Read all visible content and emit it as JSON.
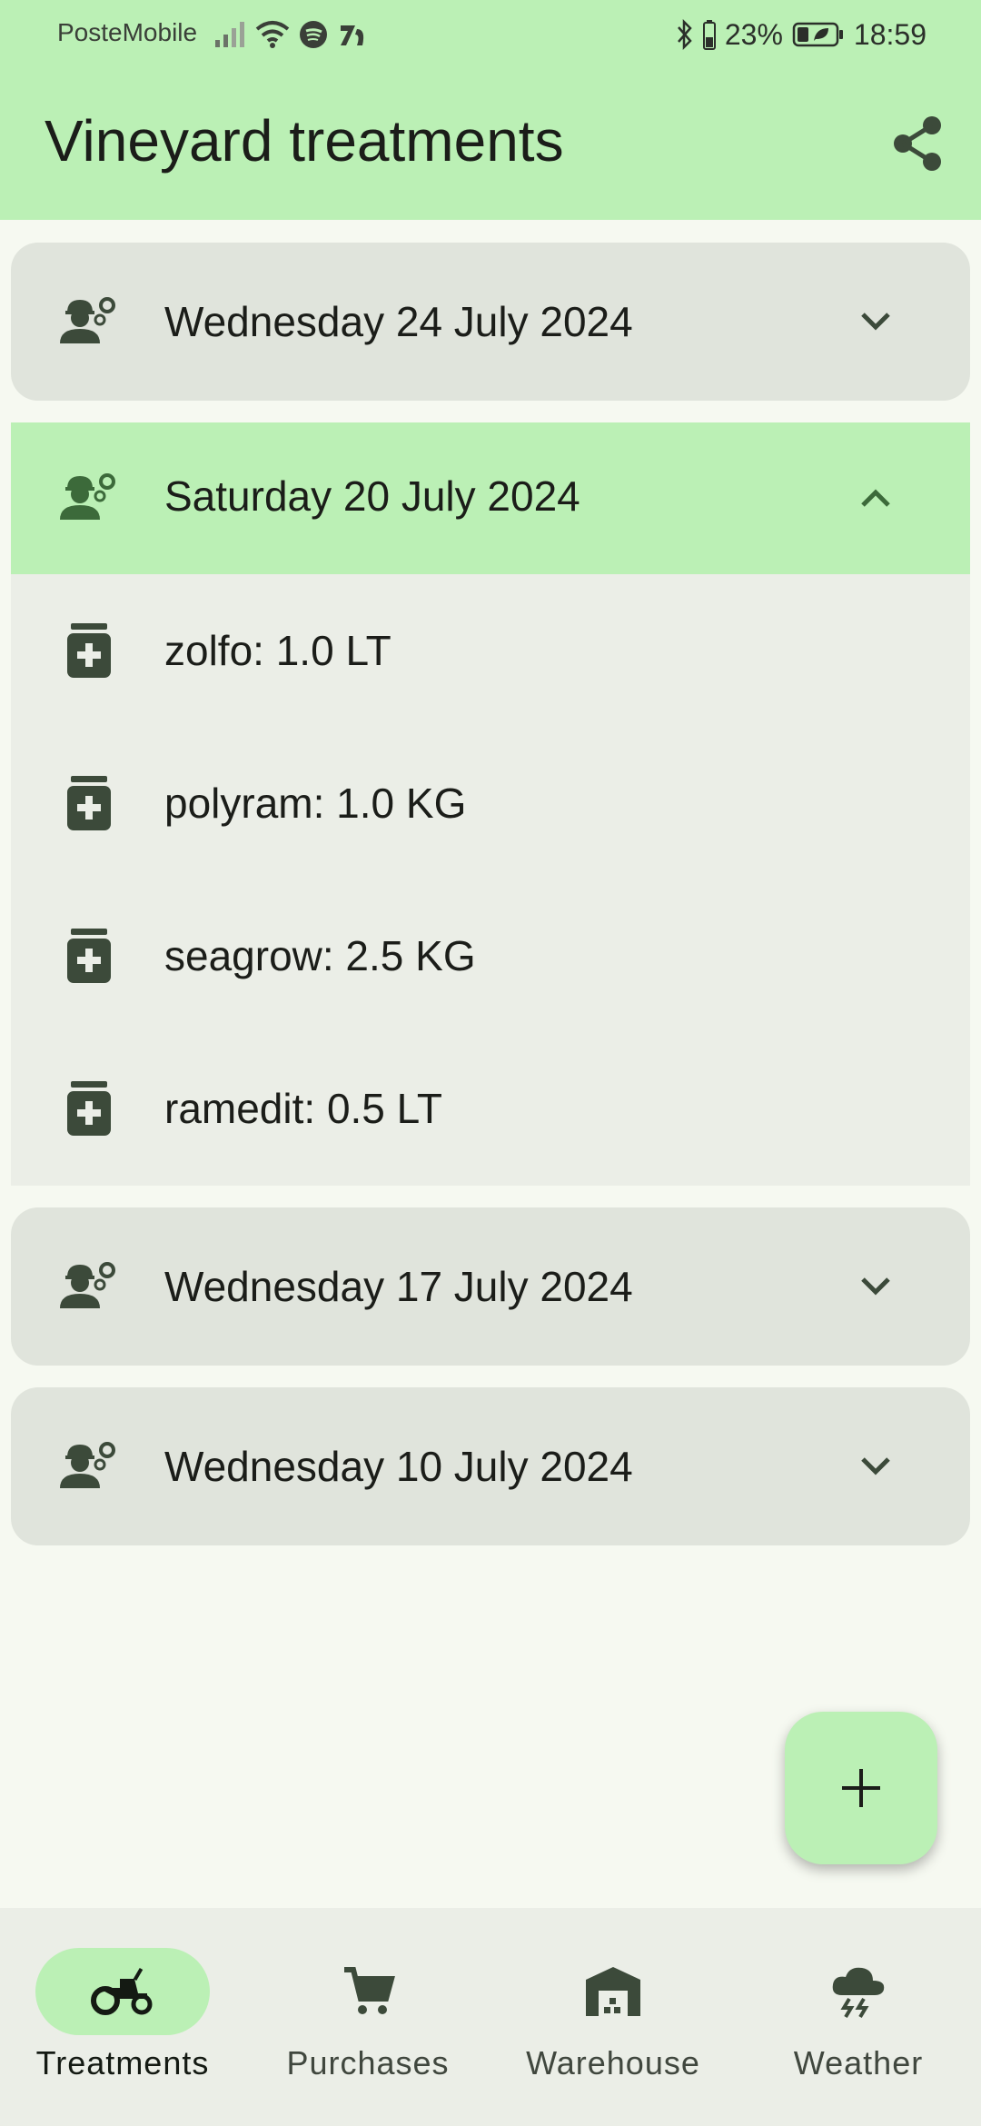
{
  "status_bar": {
    "carrier": "PosteMobile",
    "battery": "23%",
    "time": "18:59"
  },
  "header": {
    "title": "Vineyard treatments"
  },
  "treatments": [
    {
      "date": "Wednesday 24 July 2024",
      "expanded": false
    },
    {
      "date": "Saturday 20 July 2024",
      "expanded": true,
      "products": [
        {
          "label": "zolfo: 1.0 LT"
        },
        {
          "label": "polyram: 1.0 KG"
        },
        {
          "label": "seagrow: 2.5 KG"
        },
        {
          "label": "ramedit: 0.5 LT"
        }
      ]
    },
    {
      "date": "Wednesday 17 July 2024",
      "expanded": false
    },
    {
      "date": "Wednesday 10 July 2024",
      "expanded": false
    }
  ],
  "bottom_nav": [
    {
      "label": "Treatments",
      "icon": "tractor-icon",
      "active": true
    },
    {
      "label": "Purchases",
      "icon": "cart-icon",
      "active": false
    },
    {
      "label": "Warehouse",
      "icon": "warehouse-icon",
      "active": false
    },
    {
      "label": "Weather",
      "icon": "storm-cloud-icon",
      "active": false
    }
  ],
  "colors": {
    "accent": "#bbf0b5",
    "card": "#e0e4dc",
    "background": "#f6f9f1",
    "icon": "#3c4a3a"
  }
}
